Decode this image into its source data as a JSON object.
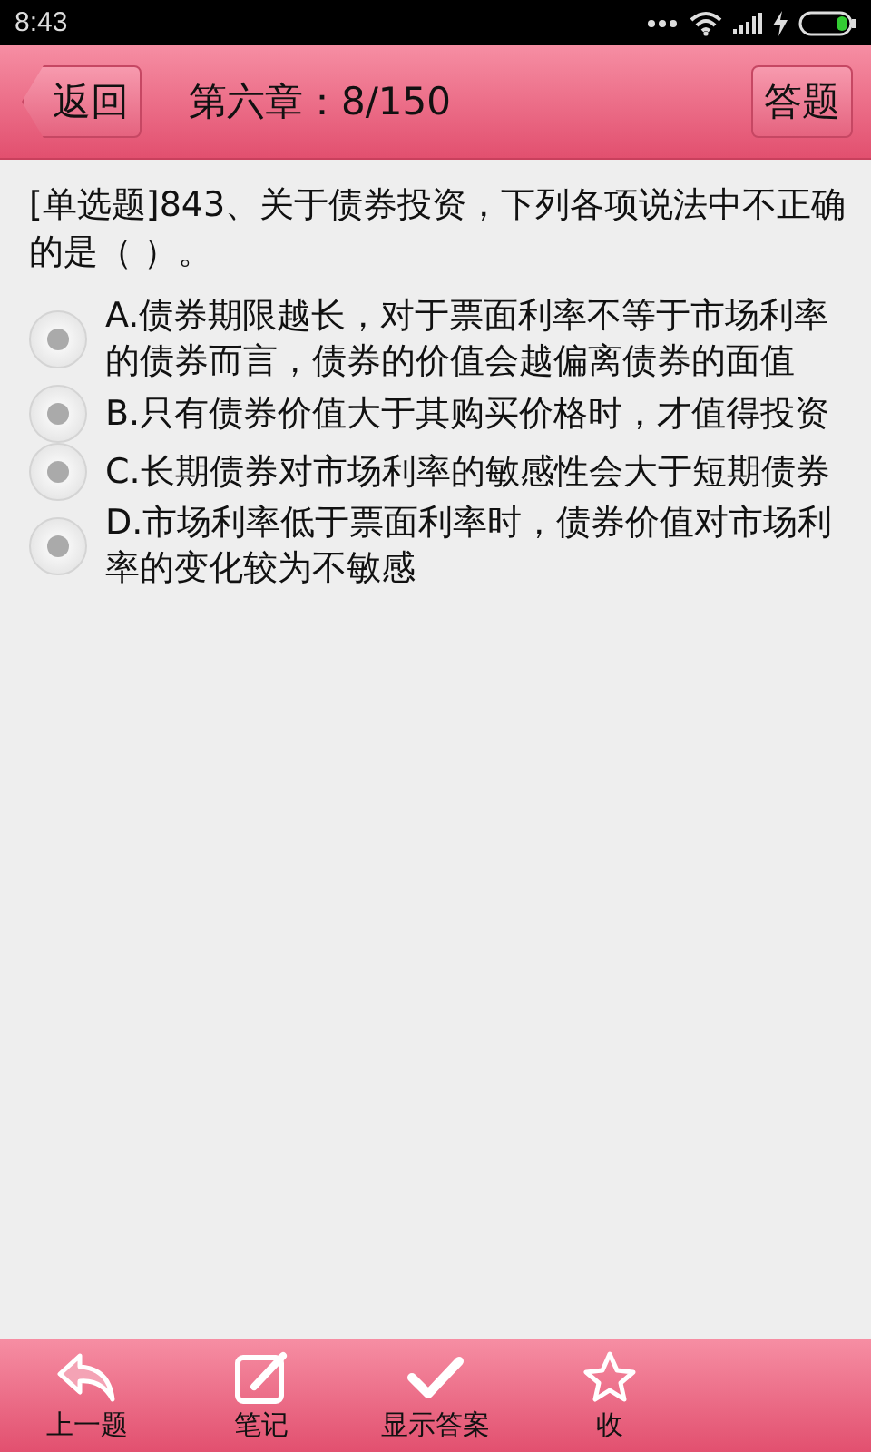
{
  "status_bar": {
    "time": "8:43"
  },
  "header": {
    "back_label": "返回",
    "title": "第六章：8/150",
    "action_label": "答题"
  },
  "question": {
    "text": "[单选题]843、关于债券投资，下列各项说法中不正确的是（ ）。"
  },
  "options": [
    {
      "text": "A.债券期限越长，对于票面利率不等于市场利率的债券而言，债券的价值会越偏离债券的面值",
      "selected": false
    },
    {
      "text": "B.只有债券价值大于其购买价格时，才值得投资",
      "selected": false
    },
    {
      "text": "C.长期债券对市场利率的敏感性会大于短期债券",
      "selected": false
    },
    {
      "text": "D.市场利率低于票面利率时，债券价值对市场利率的变化较为不敏感",
      "selected": false
    }
  ],
  "bottom_bar": [
    {
      "kind": "back",
      "label": "上一题"
    },
    {
      "kind": "note",
      "label": "笔记"
    },
    {
      "kind": "check",
      "label": "显示答案"
    },
    {
      "kind": "star",
      "label": "收"
    }
  ]
}
